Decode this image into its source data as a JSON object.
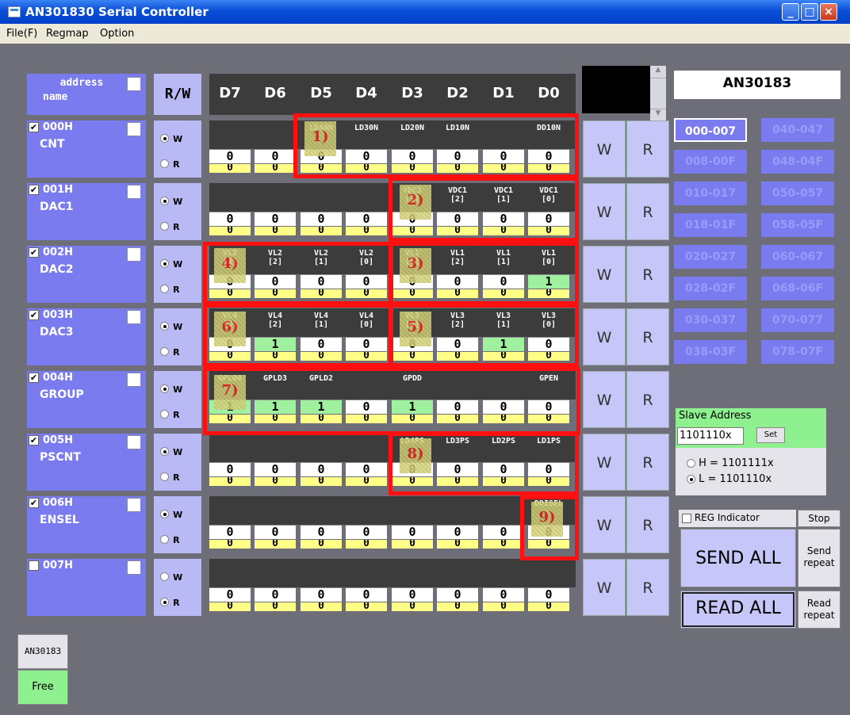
{
  "window": {
    "title": "AN301830 Serial Controller"
  },
  "menu": [
    "File(F)",
    "Regmap",
    "Option"
  ],
  "header": {
    "address": "address",
    "name": "name",
    "rw": "R/W",
    "bits": [
      "D7",
      "D6",
      "D5",
      "D4",
      "D3",
      "D2",
      "D1",
      "D0"
    ],
    "chip": "AN30183"
  },
  "registers": [
    {
      "addr": "000H",
      "name": "CNT",
      "checked": true,
      "rw": "W",
      "labels": [
        "",
        "",
        "LD40N",
        "LD30N",
        "LD20N",
        "LD10N",
        "",
        "DD10N"
      ],
      "write": [
        "0",
        "0",
        "0",
        "0",
        "0",
        "0",
        "0",
        "0"
      ],
      "read": [
        "0",
        "0",
        "0",
        "0",
        "0",
        "0",
        "0",
        "0"
      ]
    },
    {
      "addr": "001H",
      "name": "DAC1",
      "checked": true,
      "rw": "W",
      "labels": [
        "",
        "",
        "",
        "",
        "VDC1\n[3]",
        "VDC1\n[2]",
        "VDC1\n[1]",
        "VDC1\n[0]"
      ],
      "write": [
        "0",
        "0",
        "0",
        "0",
        "0",
        "0",
        "0",
        "0"
      ],
      "read": [
        "0",
        "0",
        "0",
        "0",
        "0",
        "0",
        "0",
        "0"
      ]
    },
    {
      "addr": "002H",
      "name": "DAC2",
      "checked": true,
      "rw": "W",
      "labels": [
        "VL2\n[3]",
        "VL2\n[2]",
        "VL2\n[1]",
        "VL2\n[0]",
        "VL1\n[3]",
        "VL1\n[2]",
        "VL1\n[1]",
        "VL1\n[0]"
      ],
      "write": [
        "0",
        "0",
        "0",
        "0",
        "0",
        "0",
        "0",
        "1"
      ],
      "read": [
        "0",
        "0",
        "0",
        "0",
        "0",
        "0",
        "0",
        "0"
      ]
    },
    {
      "addr": "003H",
      "name": "DAC3",
      "checked": true,
      "rw": "W",
      "labels": [
        "VL4\n[3]",
        "VL4\n[2]",
        "VL4\n[1]",
        "VL4\n[0]",
        "VL3\n[3]",
        "VL3\n[2]",
        "VL3\n[1]",
        "VL3\n[0]"
      ],
      "write": [
        "0",
        "1",
        "0",
        "0",
        "0",
        "0",
        "1",
        "0"
      ],
      "read": [
        "0",
        "0",
        "0",
        "0",
        "0",
        "0",
        "0",
        "0"
      ]
    },
    {
      "addr": "004H",
      "name": "GROUP",
      "checked": true,
      "rw": "W",
      "labels": [
        "GPLD4",
        "GPLD3",
        "GPLD2",
        "",
        "GPDD",
        "",
        "",
        "GPEN"
      ],
      "write": [
        "1",
        "1",
        "1",
        "0",
        "1",
        "0",
        "0",
        "0"
      ],
      "read": [
        "0",
        "0",
        "0",
        "0",
        "0",
        "0",
        "0",
        "0"
      ]
    },
    {
      "addr": "005H",
      "name": "PSCNT",
      "checked": true,
      "rw": "W",
      "labels": [
        "",
        "",
        "",
        "",
        "LD4PS",
        "LD3PS",
        "LD2PS",
        "LD1PS"
      ],
      "write": [
        "0",
        "0",
        "0",
        "0",
        "0",
        "0",
        "0",
        "0"
      ],
      "read": [
        "0",
        "0",
        "0",
        "0",
        "0",
        "0",
        "0",
        "0"
      ]
    },
    {
      "addr": "006H",
      "name": "ENSEL",
      "checked": true,
      "rw": "W",
      "labels": [
        "",
        "",
        "",
        "",
        "",
        "",
        "",
        "DDISEL"
      ],
      "write": [
        "0",
        "0",
        "0",
        "0",
        "0",
        "0",
        "0",
        "0"
      ],
      "read": [
        "0",
        "0",
        "0",
        "0",
        "0",
        "0",
        "0",
        "0"
      ]
    },
    {
      "addr": "007H",
      "name": "",
      "checked": false,
      "rw": "R",
      "labels": [
        "",
        "",
        "",
        "",
        "",
        "",
        "",
        ""
      ],
      "write": [
        "0",
        "0",
        "0",
        "0",
        "0",
        "0",
        "0",
        "0"
      ],
      "read": [
        "0",
        "0",
        "0",
        "0",
        "0",
        "0",
        "0",
        "0"
      ]
    }
  ],
  "rw_labels": {
    "w": "W",
    "r": "R"
  },
  "button_labels": {
    "write": "W",
    "read": "R"
  },
  "ranges": [
    [
      "000-007",
      "040-047"
    ],
    [
      "008-00F",
      "048-04F"
    ],
    [
      "010-017",
      "050-057"
    ],
    [
      "018-01F",
      "058-05F"
    ],
    [
      "020-027",
      "060-067"
    ],
    [
      "028-02F",
      "068-06F"
    ],
    [
      "030-037",
      "070-077"
    ],
    [
      "038-03F",
      "078-07F"
    ]
  ],
  "slave": {
    "title": "Slave Address",
    "value": "1101110x",
    "set": "Set",
    "opt_h": "H = 1101111x",
    "opt_l": "L = 1101110x",
    "selected": "L"
  },
  "controls": {
    "reg_indicator": "REG Indicator",
    "stop": "Stop",
    "send_all": "SEND ALL",
    "send_repeat": "Send\nrepeat",
    "read_all": "READ ALL",
    "read_repeat": "Read\nrepeat"
  },
  "status": {
    "device": "AN30183",
    "state": "Free"
  },
  "annotations": [
    "1)",
    "2)",
    "3)",
    "4)",
    "5)",
    "6)",
    "7)",
    "8)",
    "9)"
  ],
  "colors": {
    "row_blue": "#7b7bf0",
    "rw_light": "#b9b9f5",
    "dark": "#3c3c3c",
    "yellow": "#ffff88",
    "green": "#9ff09f",
    "red": "#ff1010"
  }
}
